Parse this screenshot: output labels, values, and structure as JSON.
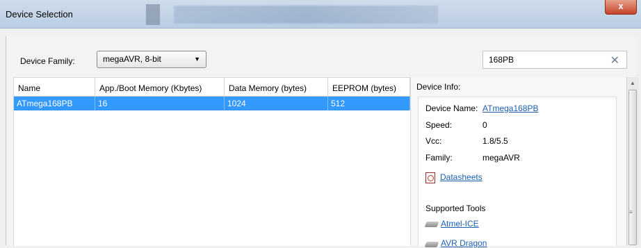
{
  "window": {
    "title": "Device Selection",
    "close_label": "x"
  },
  "filter": {
    "device_family_label": "Device Family:",
    "device_family_value": "megaAVR, 8-bit",
    "search_value": "168PB"
  },
  "table": {
    "columns": [
      "Name",
      "App./Boot Memory (Kbytes)",
      "Data Memory (bytes)",
      "EEPROM (bytes)"
    ],
    "rows": [
      {
        "name": "ATmega168PB",
        "app_boot_memory": "16",
        "data_memory": "1024",
        "eeprom": "512"
      }
    ]
  },
  "device_info": {
    "title": "Device Info:",
    "device_name_label": "Device Name:",
    "device_name_value": "ATmega168PB",
    "speed_label": "Speed:",
    "speed_value": "0",
    "vcc_label": "Vcc:",
    "vcc_value": "1.8/5.5",
    "family_label": "Family:",
    "family_value": "megaAVR",
    "datasheets_label": "Datasheets",
    "supported_tools_label": "Supported Tools",
    "tools": [
      "Atmel-ICE",
      "AVR Dragon"
    ]
  },
  "icons": {
    "pdf": "pdf-icon",
    "tool": "debugger-tool-icon",
    "dropdown": "chevron-down-icon",
    "clear": "close-icon"
  },
  "colors": {
    "selection": "#3399ff",
    "link": "#1a5fb4",
    "close_button": "#c4432b"
  }
}
